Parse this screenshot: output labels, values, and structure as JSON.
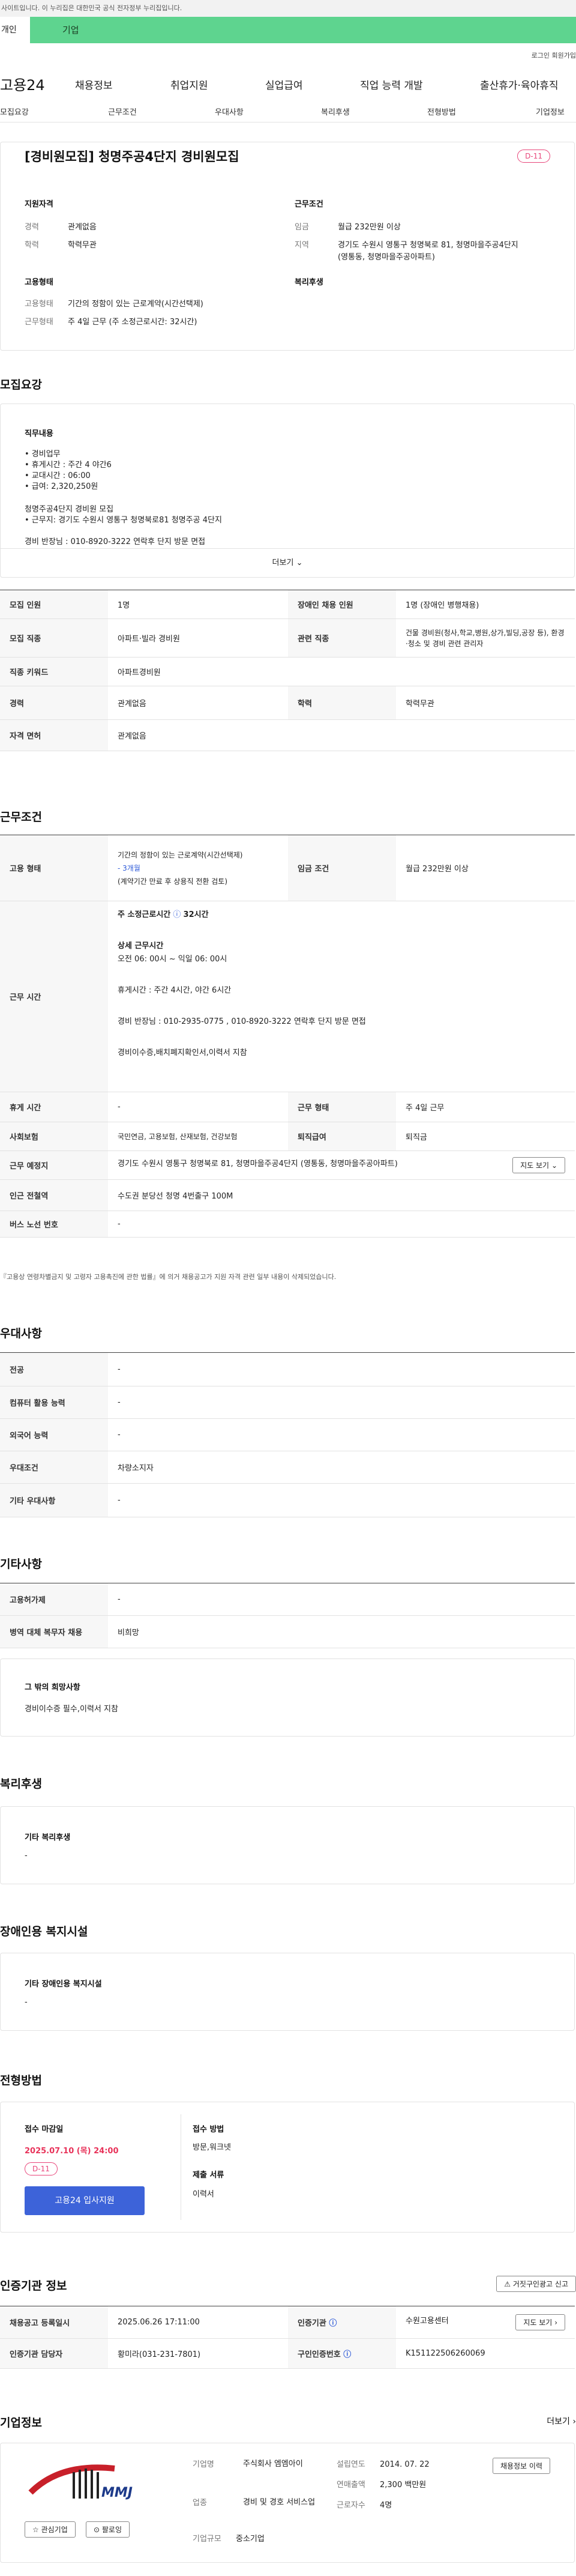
{
  "gov_bar": "사이트입니다. 이 누리집은 대한민국 공식 전자정부 누리집입니다.",
  "top_tabs": {
    "person": "개인",
    "company": "기업"
  },
  "util": {
    "login": "로그인",
    "join": "회원가입"
  },
  "gnb": {
    "logo": "고용24",
    "menu": [
      "채용정보",
      "취업지원",
      "실업급여",
      "직업 능력 개발",
      "출산휴가·육아휴직"
    ]
  },
  "subnav": [
    "모집요강",
    "근무조건",
    "우대사항",
    "복리후생",
    "전형방법",
    "기업정보"
  ],
  "summary": {
    "title": "[경비원모집] 청명주공4단지 경비원모집",
    "dday": "D-11",
    "qual_h": "지원자격",
    "career_k": "경력",
    "career_v": "관계없음",
    "edu_k": "학력",
    "edu_v": "학력무관",
    "work_h": "근무조건",
    "pay_k": "임금",
    "pay_v": "월급 232만원 이상",
    "area_k": "지역",
    "area_v1": "경기도 수원시 영통구 청명북로 81, 청명마을주공4단지",
    "area_v2": "(영통동, 청명마을주공아파트)",
    "emp_h": "고용형태",
    "emp_k": "고용형태",
    "emp_v": "기간의 정함이 있는 근로계약(시간선택제)",
    "wt_k": "근무형태",
    "wt_v": "주 4일 근무 (주 소정근로시간: 32시간)",
    "welfare_h": "복리후생"
  },
  "recruit": {
    "title": "모집요강",
    "duty_h": "직무내용",
    "lines": [
      "• 경비업무",
      "• 휴게시간 : 주간 4 야간6",
      "• 교대시간 : 06:00",
      "• 급여: 2,320,250원"
    ],
    "lines2": [
      "청명주공4단지 경비원 모집",
      "• 근무지: 경기도 수원시 영통구 청명북로81  청명주공 4단지"
    ],
    "line3": "경비 반장님 : 010-8920-3222  연락후 단지 방문 면접",
    "more": "더보기",
    "rows": [
      {
        "k1": "모집 인원",
        "v1": "1명",
        "k2": "장애인 채용 인원",
        "v2": "1명 (장애인 병행채용)"
      },
      {
        "k1": "모집 직종",
        "v1": "아파트·빌라 경비원",
        "k2": "관련 직종",
        "v2": "건물 경비원(청사,학교,병원,상가,빌딩,공장 등), 환경·청소 및 경비 관련 관리자"
      },
      {
        "k1": "직종 키워드",
        "v1": "아파트경비원"
      },
      {
        "k1": "경력",
        "v1": "관계없음",
        "k2": "학력",
        "v2": "학력무관"
      },
      {
        "k1": "자격 면허",
        "v1": "관계없음"
      }
    ]
  },
  "work": {
    "title": "근무조건",
    "emp_k": "고용 형태",
    "emp_v1": "기간의 정함이 있는 근로계약(시간선택제)",
    "emp_v2": "- 3개월",
    "emp_v3": "(계약기간 만료 후 상용직 전환 검토)",
    "pay_k": "임금 조건",
    "pay_v": "월급 232만원 이상",
    "time_k": "근무 시간",
    "time_main": "주 소정근로시간",
    "time_hours": "32시간",
    "detail_h": "상세 근무시간",
    "detail_v": "오전 06: 00시 ~ 익일 06: 00시",
    "rest": "휴게시간 : 주간 4시간, 야간 6시간",
    "contact": "경비 반장님 : 010-2935-0775 ,  010-8920-3222  연락후 단지 방문 면접",
    "prefer_line": "경비이수증,배치폐지확인서,이력서  지참",
    "rest_k": "휴게 시간",
    "rest_v": "-",
    "form_k": "근무 형태",
    "form_v": "주 4일 근무",
    "ins_k": "사회보험",
    "ins_v": "국민연금, 고용보험, 산재보험, 건강보험",
    "sev_k": "퇴직급여",
    "sev_v": "퇴직금",
    "place_k": "근무 예정지",
    "place_v": "경기도 수원시 영통구 청명북로 81, 청명마을주공4단지 (영통동, 청명마을주공아파트)",
    "map_btn": "지도 보기",
    "sub_k": "인근 전철역",
    "sub_v": "수도권 분당선 청명 4번출구 100M",
    "bus_k": "버스 노선 번호",
    "bus_v": "-",
    "note": "『고용상 연령차별금지 및 고령자 고용촉진에 관한 법률』에 의거 채용공고가 지원 자격 관련 일부 내용이 삭제되었습니다."
  },
  "prefer": {
    "title": "우대사항",
    "rows": [
      {
        "k": "전공",
        "v": "-"
      },
      {
        "k": "컴퓨터 활용 능력",
        "v": "-"
      },
      {
        "k": "외국어 능력",
        "v": "-"
      },
      {
        "k": "우대조건",
        "v": "차량소지자"
      },
      {
        "k": "기타 우대사항",
        "v": "-"
      }
    ]
  },
  "etc": {
    "title": "기타사항",
    "rows": [
      {
        "k": "고용허가제",
        "v": "-"
      },
      {
        "k": "병역 대체 복무자 채용",
        "v": "비희망"
      }
    ],
    "box_h": "그 밖의 희망사항",
    "box_v": "경비이수증 필수,이력서 지참"
  },
  "welfare": {
    "title": "복리후생",
    "box_h": "기타 복리후생",
    "box_v": "-"
  },
  "disab": {
    "title": "장애인용 복지시설",
    "box_h": "기타 장애인용 복지시설",
    "box_v": "-"
  },
  "screen": {
    "title": "전형방법",
    "deadline_h": "접수 마감일",
    "deadline_v": "2025.07.10 (목) 24:00",
    "dday": "D-11",
    "apply": "고용24 입사지원",
    "method_h": "접수 방법",
    "method_v": "방문,워크넷",
    "docs_h": "제출 서류",
    "docs_v": "이력서"
  },
  "agency": {
    "title": "인증기관 정보",
    "report_btn": "거짓구인광고 신고",
    "reg_k": "채용공고 등록일시",
    "reg_v": "2025.06.26 17:11:00",
    "org_k": "인증기관",
    "org_v": "수원고용센터",
    "map_btn": "지도 보기",
    "mgr_k": "인증기관 담당자",
    "mgr_v": "황미라(031-231-7801)",
    "num_k": "구인인증번호",
    "num_v": "K151122506260069"
  },
  "company": {
    "title": "기업정보",
    "more": "더보기",
    "logo_text": "MMJ",
    "fav": "관심기업",
    "follow": "팔로잉",
    "name_k": "기업명",
    "name_v": "주식회사 엠엠아이",
    "est_k": "설립연도",
    "est_v": "2014. 07. 22",
    "ind_k": "업종",
    "ind_v": "경비 및 경호 서비스업",
    "sales_k": "연매출액",
    "sales_v": "2,300 백만원",
    "emp_k": "근로자수",
    "emp_v": "4명",
    "size_k": "기업규모",
    "size_v": "중소기업",
    "history_btn": "채용정보 이력"
  },
  "colors": {
    "accent": "#3d63d9",
    "green": "#5ed48f",
    "dday": "#e8457a"
  }
}
